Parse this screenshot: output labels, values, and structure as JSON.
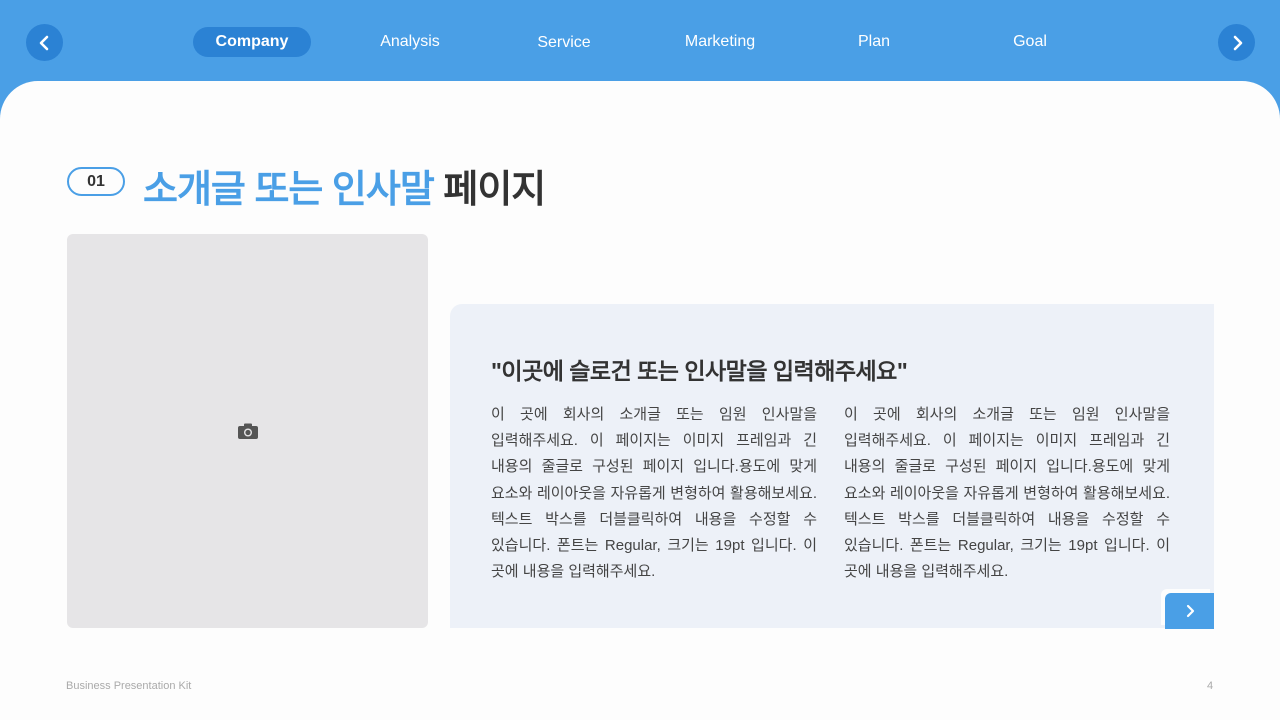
{
  "nav": {
    "tabs": [
      {
        "label": "Company",
        "active": true
      },
      {
        "label": "Analysis",
        "active": false
      },
      {
        "label": "Service",
        "active": false
      },
      {
        "label": "Marketing",
        "active": false
      },
      {
        "label": "Plan",
        "active": false
      },
      {
        "label": "Goal",
        "active": false
      }
    ],
    "prev_icon": "chevron-left-icon",
    "next_icon": "chevron-right-icon"
  },
  "section": {
    "number": "01",
    "title_accent": "소개글 또는 인사말",
    "title_rest": " 페이지"
  },
  "image_placeholder": {
    "icon": "camera-icon"
  },
  "content": {
    "slogan": "\"이곳에 슬로건 또는 인사말을 입력해주세요\"",
    "col1": "이 곳에 회사의 소개글 또는 임원 인사말을 입력해주세요. 이 페이지는 이미지 프레임과 긴 내용의 줄글로 구성된 페이지 입니다.용도에 맞게 요소와 레이아웃을 자유롭게 변형하여 활용해보세요. 텍스트 박스를 더블클릭하여 내용을 수정할 수 있습니다. 폰트는 Regular, 크기는 19pt 입니다. 이 곳에 내용을 입력해주세요.",
    "col2": "이 곳에 회사의 소개글 또는 임원 인사말을 입력해주세요. 이 페이지는 이미지 프레임과 긴 내용의 줄글로 구성된 페이지 입니다.용도에 맞게 요소와 레이아웃을 자유롭게 변형하여 활용해보세요. 텍스트 박스를 더블클릭하여 내용을 수정할 수 있습니다. 폰트는 Regular, 크기는 19pt 입니다. 이 곳에 내용을 입력해주세요."
  },
  "footer": {
    "brand": "Business Presentation Kit",
    "page_number": "4"
  },
  "colors": {
    "primary": "#4a9fe6",
    "primary_dark": "#2b82d4",
    "card_bg": "#edf1f8",
    "photo_bg": "#e6e5e7"
  }
}
